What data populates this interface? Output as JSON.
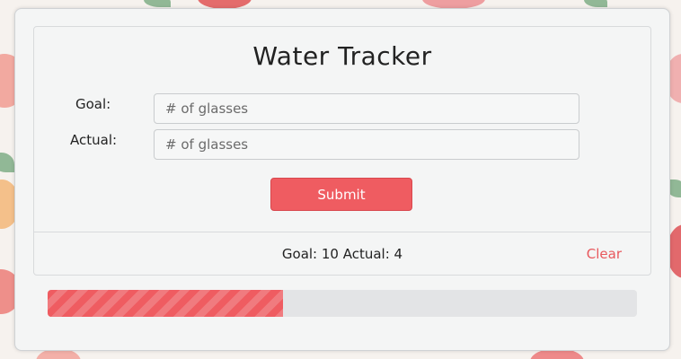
{
  "app": {
    "title": "Water Tracker"
  },
  "form": {
    "goal_label": "Goal:",
    "goal_value": "",
    "goal_placeholder": "# of glasses",
    "actual_label": "Actual:",
    "actual_value": "",
    "actual_placeholder": "# of glasses",
    "submit_label": "Submit"
  },
  "summary": {
    "text": "Goal: 10 Actual: 4",
    "clear_label": "Clear"
  },
  "progress": {
    "fraction": 0.4
  },
  "colors": {
    "accent": "#ef5c61",
    "track": "#e3e4e6"
  }
}
